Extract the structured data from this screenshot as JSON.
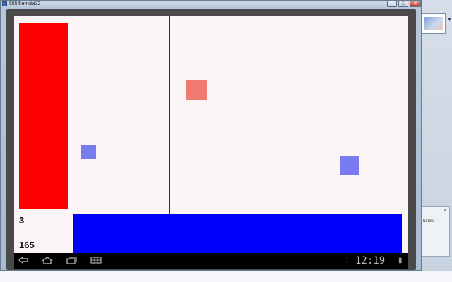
{
  "window": {
    "title": "5554:emula32",
    "minimize_label": "–",
    "maximize_label": "□",
    "close_label": "✕"
  },
  "game": {
    "counter_top": "3",
    "counter_bottom": "165",
    "colors": {
      "red_bar": "#ff0000",
      "blue_bar": "#0000ff",
      "red_square": "#f07a72",
      "blue_square": "#7a7bf0",
      "background": "#fbf5f5",
      "crosshair_horizontal": "#e05555",
      "crosshair_vertical": "#333333"
    }
  },
  "system_bar": {
    "clock": "12:19",
    "icons": {
      "back": "back-icon",
      "home": "home-icon",
      "recent": "recent-apps-icon",
      "menu": "menu-icon",
      "notification": "screenshot-icon",
      "battery": "battery-icon"
    }
  },
  "side_panel": {
    "text": "fundo"
  }
}
